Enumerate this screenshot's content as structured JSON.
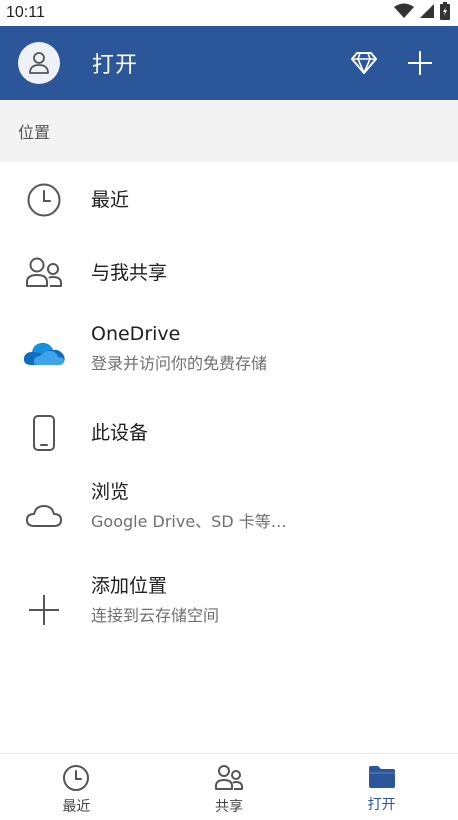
{
  "status_bar": {
    "time": "10:11"
  },
  "app_bar": {
    "title": "打开"
  },
  "section": {
    "header": "位置"
  },
  "locations": [
    {
      "label": "最近",
      "icon": "clock-icon"
    },
    {
      "label": "与我共享",
      "icon": "people-icon"
    },
    {
      "label": "OneDrive",
      "subtitle": "登录并访问你的免费存储",
      "icon": "onedrive-cloud-icon"
    },
    {
      "label": "此设备",
      "icon": "phone-icon"
    },
    {
      "label": "浏览",
      "subtitle": "Google Drive、SD 卡等…",
      "icon": "cloud-outline-icon"
    },
    {
      "label": "添加位置",
      "subtitle": "连接到云存储空间",
      "icon": "plus-icon"
    }
  ],
  "bottom_nav": [
    {
      "label": "最近",
      "icon": "clock-icon",
      "active": false
    },
    {
      "label": "共享",
      "icon": "people-icon",
      "active": false
    },
    {
      "label": "打开",
      "icon": "folder-icon",
      "active": true
    }
  ],
  "colors": {
    "brand": "#2b579a",
    "section_bg": "#f3f3f3",
    "onedrive_blue": "#0f6cbd"
  }
}
